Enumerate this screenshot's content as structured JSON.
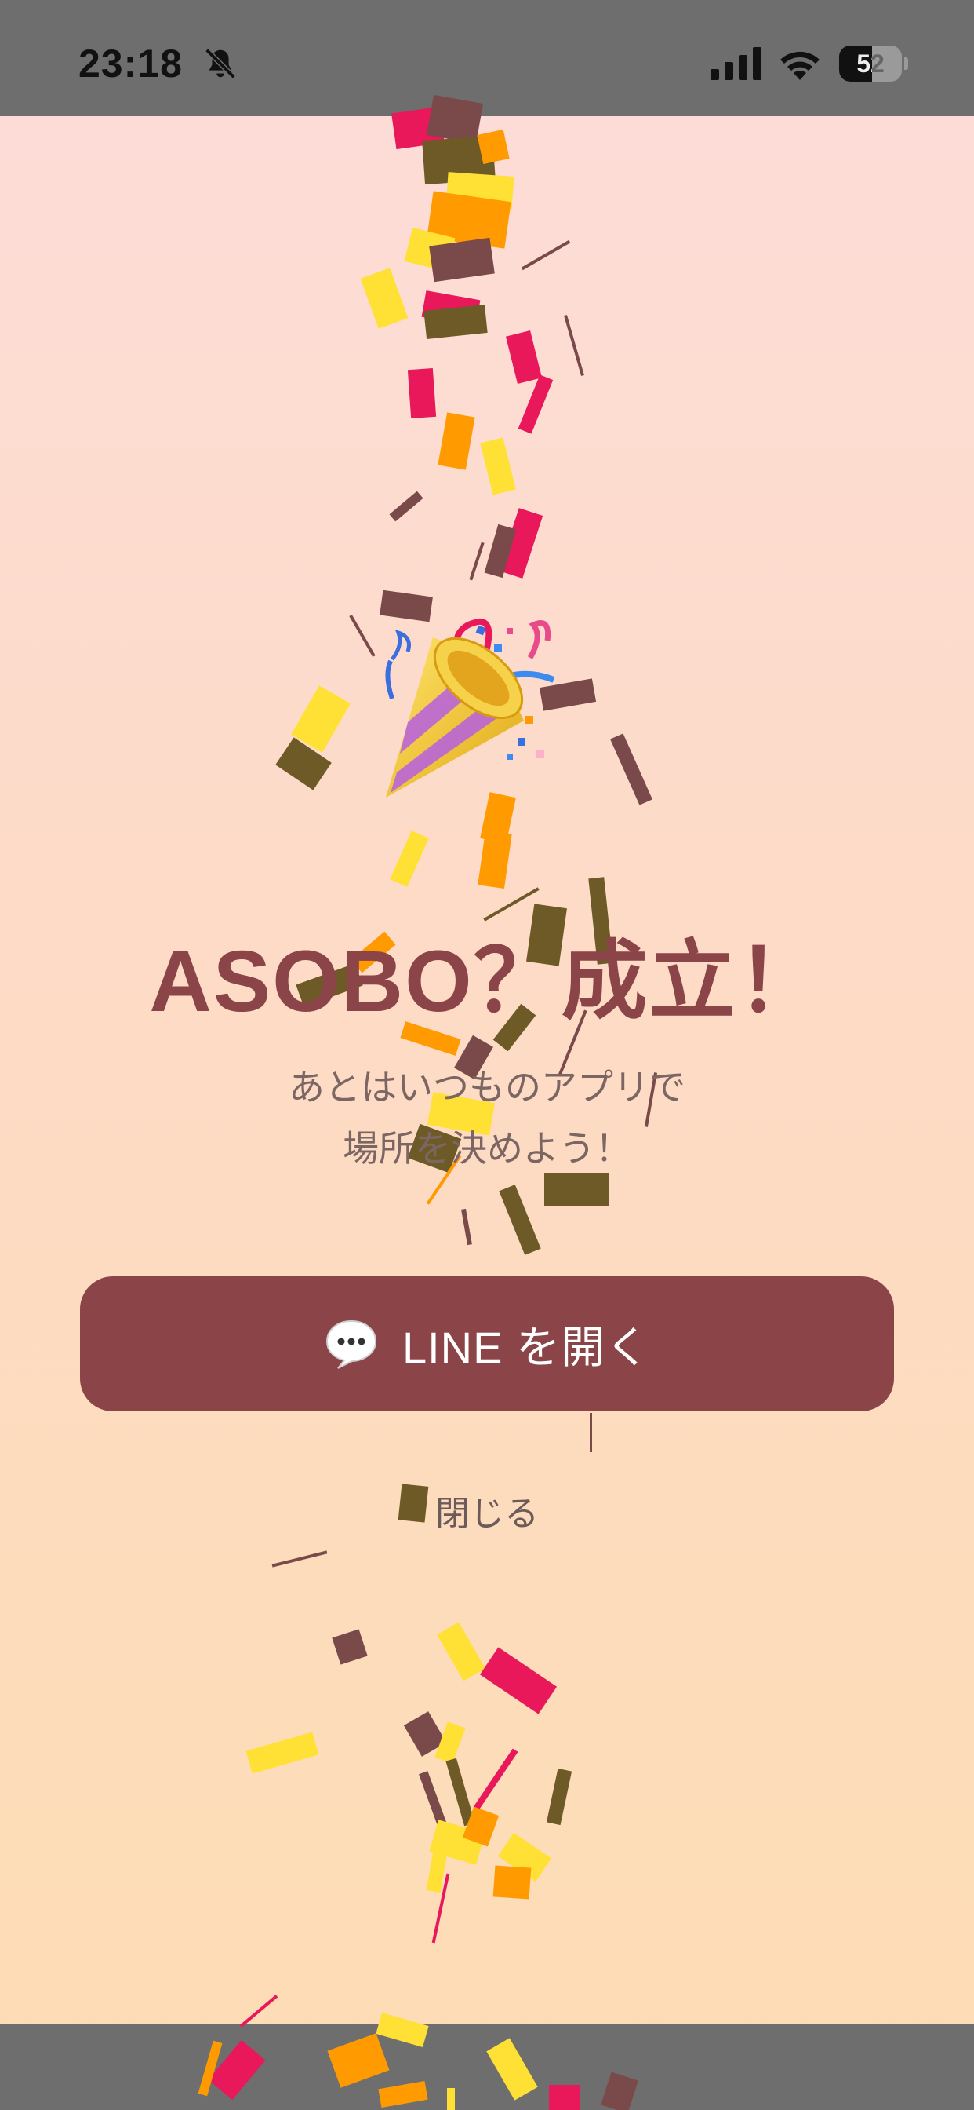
{
  "status_bar": {
    "time": "23:18",
    "battery_level": "52"
  },
  "celebration": {
    "title": "ASOBO？成立！",
    "subtitle_line1": "あとはいつものアプリで",
    "subtitle_line2": "場所を決めよう！"
  },
  "actions": {
    "open_line_label": "LINE を開く",
    "close_label": "閉じる"
  },
  "icons": {
    "party_popper": "party-popper-icon",
    "speech_bubble": "speech-bubble-icon",
    "bell_off": "bell-off-icon"
  },
  "colors": {
    "accent": "#8b4447",
    "background_top": "#fddcda",
    "background_bottom": "#fddcb4",
    "confetti": [
      "#e8185a",
      "#ffe135",
      "#ff9a00",
      "#7b5b24",
      "#7a4a4a"
    ]
  }
}
